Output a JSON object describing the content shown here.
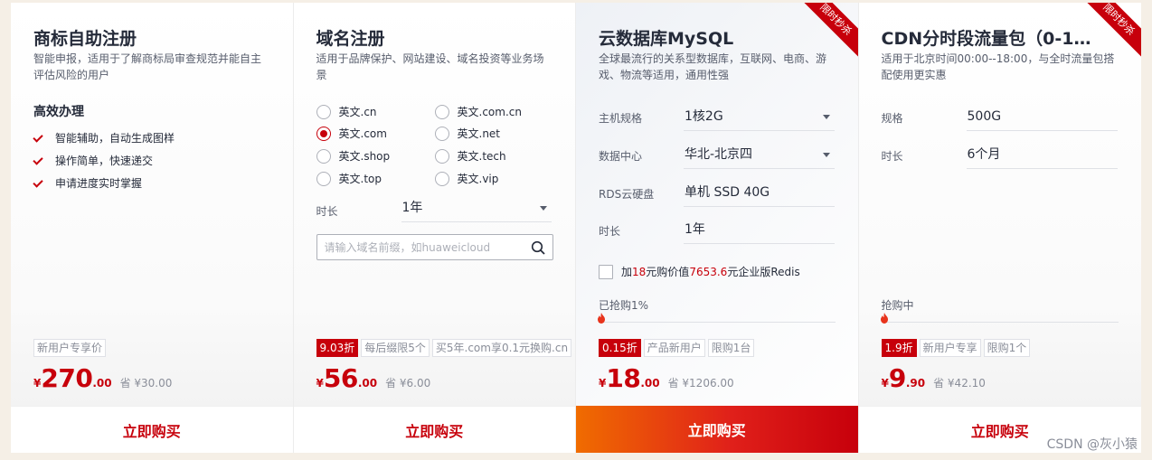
{
  "cards": [
    {
      "title": "商标自助注册",
      "desc": "智能申报，适用于了解商标局审查规范并能自主评估风险的用户",
      "feature_title": "高效办理",
      "features": [
        "智能辅助，自动生成图样",
        "操作简单，快速递交",
        "申请进度实时掌握"
      ],
      "tags": [
        "新用户专享价"
      ],
      "price": {
        "currency": "¥",
        "integer": "270",
        "decimal": ".00",
        "save": "省 ¥30.00"
      },
      "buy_label": "立即购买"
    },
    {
      "title": "域名注册",
      "desc": "适用于品牌保护、网站建设、域名投资等业务场景",
      "options": [
        {
          "label": "英文.cn",
          "selected": false
        },
        {
          "label": "英文.com.cn",
          "selected": false
        },
        {
          "label": "英文.com",
          "selected": true
        },
        {
          "label": "英文.net",
          "selected": false
        },
        {
          "label": "英文.shop",
          "selected": false
        },
        {
          "label": "英文.tech",
          "selected": false
        },
        {
          "label": "英文.top",
          "selected": false
        },
        {
          "label": "英文.vip",
          "selected": false
        }
      ],
      "duration_label": "时长",
      "duration_value": "1年",
      "search_placeholder": "请输入域名前缀，如huaweicloud",
      "tags": [
        "9.03折",
        "每后缀限5个",
        "买5年.com享0.1元换购.cn"
      ],
      "price": {
        "currency": "¥",
        "integer": "56",
        "decimal": ".00",
        "save": "省 ¥6.00"
      },
      "buy_label": "立即购买"
    },
    {
      "title": "云数据库MySQL",
      "corner_badge": "限时秒杀",
      "desc": "全球最流行的关系型数据库，互联网、电商、游戏、物流等适用，通用性强",
      "fields": [
        {
          "label": "主机规格",
          "value": "1核2G",
          "dropdown": true
        },
        {
          "label": "数据中心",
          "value": "华北-北京四",
          "dropdown": true
        },
        {
          "label": "RDS云硬盘",
          "value": "单机 SSD 40G",
          "dropdown": false
        },
        {
          "label": "时长",
          "value": "1年",
          "dropdown": false
        }
      ],
      "addon": {
        "prefix": "加",
        "price": "18",
        "mid": "元购价值",
        "value": "7653.6",
        "suffix": "元企业版Redis"
      },
      "progress_label": "已抢购1%",
      "progress": 0.01,
      "tags": [
        "0.15折",
        "产品新用户",
        "限购1台"
      ],
      "price": {
        "currency": "¥",
        "integer": "18",
        "decimal": ".00",
        "save": "省 ¥1206.00"
      },
      "buy_label": "立即购买"
    },
    {
      "title": "CDN分时段流量包（0-18...",
      "corner_badge": "限时秒杀",
      "desc": "适用于北京时间00:00--18:00，与全时流量包搭配使用更实惠",
      "fields": [
        {
          "label": "规格",
          "value": "500G"
        },
        {
          "label": "时长",
          "value": "6个月"
        }
      ],
      "progress_label": "抢购中",
      "progress": 0.0,
      "tags": [
        "1.9折",
        "新用户专享",
        "限购1个"
      ],
      "price": {
        "currency": "¥",
        "integer": "9",
        "decimal": ".90",
        "save": "省 ¥42.10"
      },
      "buy_label": "立即购买"
    }
  ],
  "watermark": "CSDN @灰小猿",
  "colors": {
    "accent": "#c7000b",
    "gradient_start": "#f06c00",
    "text": "#252b3a",
    "muted": "#8a8e99"
  }
}
